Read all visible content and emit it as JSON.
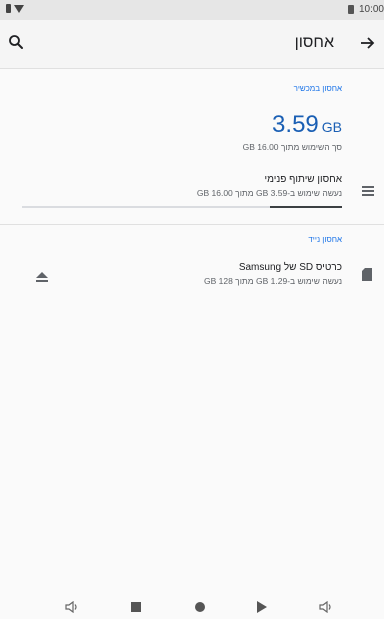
{
  "status_bar": {
    "time": "10:00"
  },
  "app_bar": {
    "title": "אחסון"
  },
  "device_storage": {
    "section_label": "אחסון במכשיר",
    "used_number": "3.59",
    "used_unit": "GB",
    "total_label": "סך השימוש מתוך 16.00 GB",
    "internal": {
      "title": "אחסון שיתוף פנימי",
      "subtitle": "נעשה שימוש ב-3.59 GB מתוך 16.00 GB",
      "used_fraction": 0.224
    }
  },
  "portable_storage": {
    "section_label": "אחסון נייד",
    "sd_card": {
      "title": "כרטיס SD של Samsung",
      "subtitle": "נעשה שימוש ב-1.29 GB מתוך 128 GB"
    }
  },
  "icons": {
    "search": "search-icon",
    "back": "arrow-right-icon",
    "storage": "storage-list-icon",
    "eject": "eject-icon",
    "sd_card": "sd-card-icon"
  },
  "colors": {
    "accent": "#1a73e8",
    "size_text": "#1a5fb4"
  }
}
